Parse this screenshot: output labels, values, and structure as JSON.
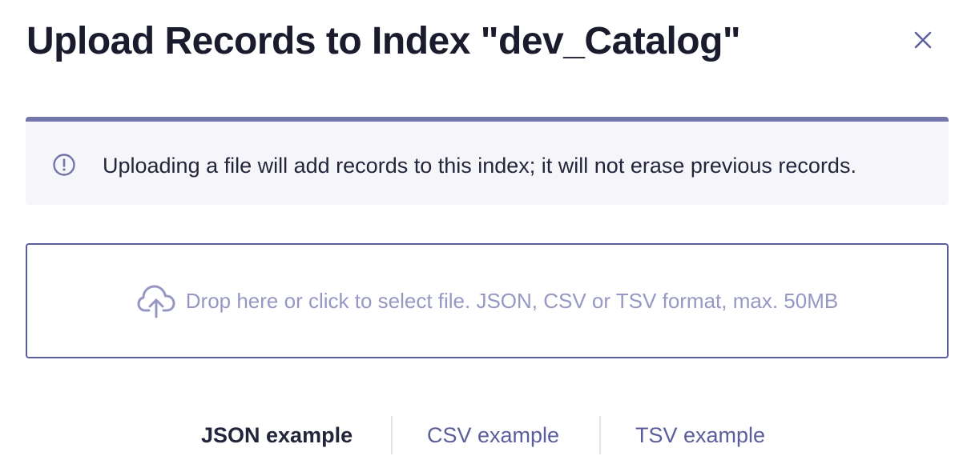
{
  "dialog": {
    "title": "Upload Records to Index \"dev_Catalog\"",
    "close_icon": "close-icon"
  },
  "notice": {
    "icon": "info-circle-icon",
    "text": "Uploading a file will add records to this index; it will not erase previous records.",
    "accent_color": "#7376ab",
    "background_color": "#f5f5fa"
  },
  "dropzone": {
    "icon": "cloud-upload-icon",
    "text": "Drop here or click to select file. JSON, CSV or TSV format, max. 50MB",
    "border_color": "#5a5e9a",
    "text_color": "#9698c3"
  },
  "examples": {
    "tabs": [
      {
        "label": "JSON example",
        "active": true
      },
      {
        "label": "CSV example",
        "active": false
      },
      {
        "label": "TSV example",
        "active": false
      }
    ]
  }
}
